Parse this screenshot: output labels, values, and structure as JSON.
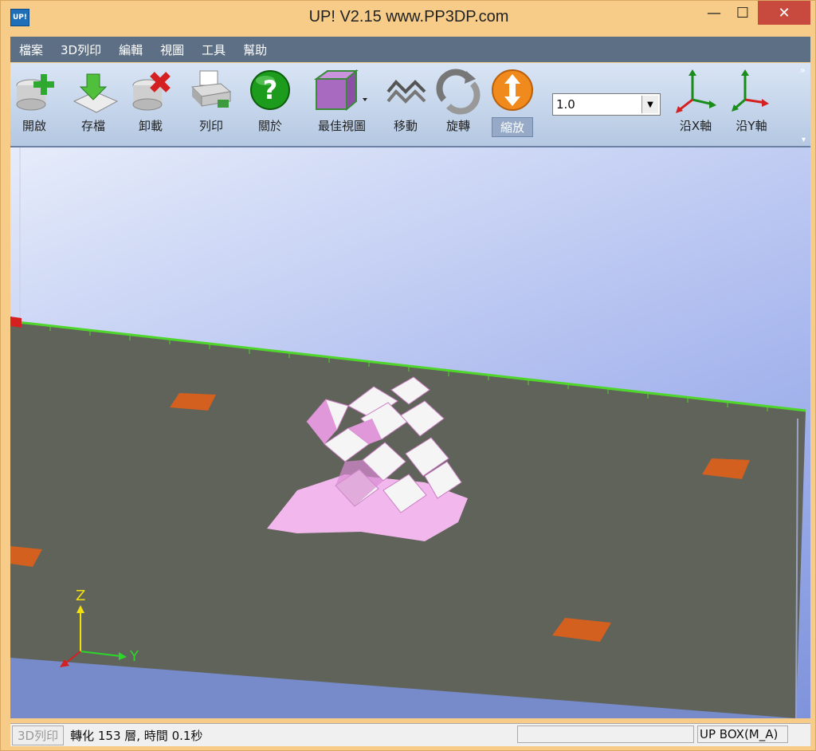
{
  "window": {
    "title": "UP!  V2.15 www.PP3DP.com",
    "app_icon_text": "UP!",
    "min_glyph": "—",
    "max_glyph": "☐",
    "close_glyph": "✕"
  },
  "menu": [
    "檔案",
    "3D列印",
    "編輯",
    "視圖",
    "工具",
    "幫助"
  ],
  "toolbar": {
    "open": "開啟",
    "save": "存檔",
    "unload": "卸載",
    "print": "列印",
    "about": "關於",
    "best_view": "最佳視圖",
    "move": "移動",
    "rotate": "旋轉",
    "scale": "縮放",
    "scale_value": "1.0",
    "along_x": "沿X軸",
    "along_y": "沿Y軸",
    "more_glyph": "»",
    "down_glyph": "▾"
  },
  "axes": {
    "z": "Z",
    "y": "Y"
  },
  "status": {
    "print_button": "3D列印",
    "message": "轉化 153 層, 時間 0.1秒",
    "printer": "UP BOX(M_A)"
  },
  "colors": {
    "platform": "#5f635a",
    "pad": "#d4601f",
    "model": "#f2b8ee",
    "ruler": "#4fd62a"
  }
}
